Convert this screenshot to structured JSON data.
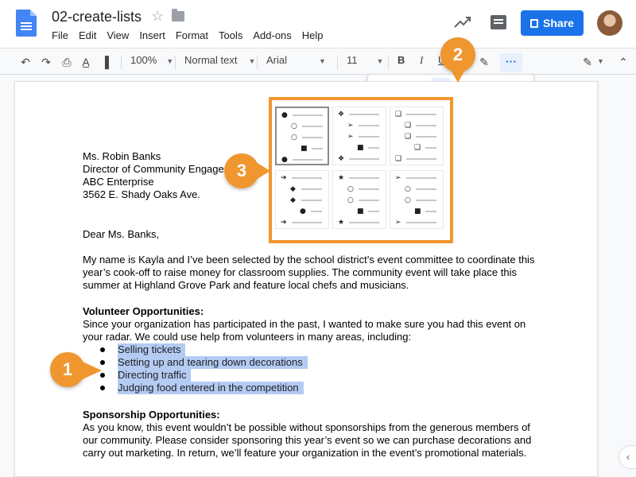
{
  "header": {
    "doc_title": "02-create-lists",
    "menu": [
      "File",
      "Edit",
      "View",
      "Insert",
      "Format",
      "Tools",
      "Add-ons",
      "Help"
    ],
    "share_label": "Share"
  },
  "toolbar": {
    "zoom": "100%",
    "style": "Normal text",
    "font": "Arial",
    "size": "11",
    "bold": "B",
    "italic": "I",
    "underline": "U",
    "more": "···"
  },
  "callouts": {
    "one": "1",
    "two": "2",
    "three": "3"
  },
  "document": {
    "address": [
      "Ms. Robin Banks",
      "Director of Community Engage",
      "ABC Enterprise",
      "3562 E. Shady Oaks Ave."
    ],
    "salutation": "Dear Ms. Banks,",
    "intro": "My name is Kayla and I’ve been selected by the school district’s event committee to coordinate this year’s cook-off to raise money for classroom supplies. The community event will take place this summer at Highland Grove Park and feature local chefs and musicians.",
    "volunteer_heading": "Volunteer Opportunities:",
    "volunteer_text": "Since your organization has participated in the past, I wanted to make sure you had this event on your radar. We could use help from volunteers in many areas, including:",
    "list_items": [
      "Selling tickets",
      "Setting up and tearing down decorations",
      "Directing traffic",
      "Judging food entered in the competition"
    ],
    "sponsorship_heading": "Sponsorship Opportunities:",
    "sponsorship_text": "As you know, this event wouldn’t be possible without sponsorships from the generous members of our community. Please consider sponsoring this year’s event so we can purchase decorations and carry out marketing. In return, we’ll feature your organization in the event’s promotional materials."
  },
  "colors": {
    "accent": "#f0962e",
    "share": "#1a73e8",
    "highlight": "#b4cbf3"
  }
}
